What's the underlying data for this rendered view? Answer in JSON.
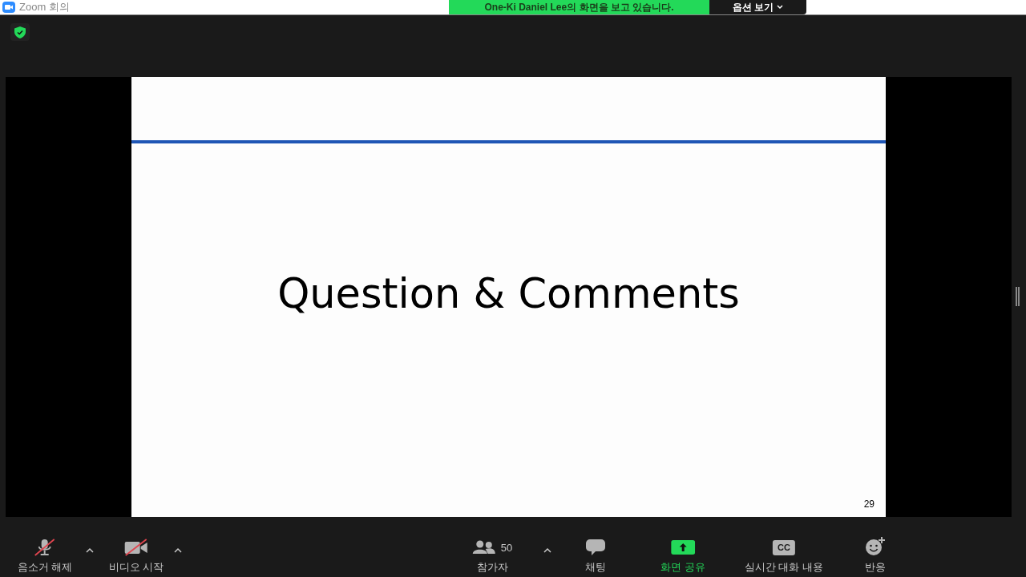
{
  "window": {
    "title": "Zoom 회의"
  },
  "share_banner": {
    "text": "One-Ki Daniel Lee의 화면을 보고 있습니다.",
    "options_button": "옵션 보기"
  },
  "slide": {
    "title": "Question & Comments",
    "page_number": "29"
  },
  "toolbar": [
    {
      "kind": "mic",
      "label": "음소거 해제",
      "off": true,
      "menu": true
    },
    {
      "kind": "video",
      "label": "비디오 시작",
      "off": true,
      "menu": true
    },
    {
      "kind": "participants",
      "label": "참가자",
      "count": "50",
      "menu": true
    },
    {
      "kind": "chat",
      "label": "채팅",
      "menu": false
    },
    {
      "kind": "share",
      "label": "화면 공유",
      "menu": false
    },
    {
      "kind": "cc",
      "label": "실시간 대화 내용",
      "icon_text": "CC",
      "menu": false
    },
    {
      "kind": "reactions",
      "label": "반응",
      "menu": false
    }
  ]
}
